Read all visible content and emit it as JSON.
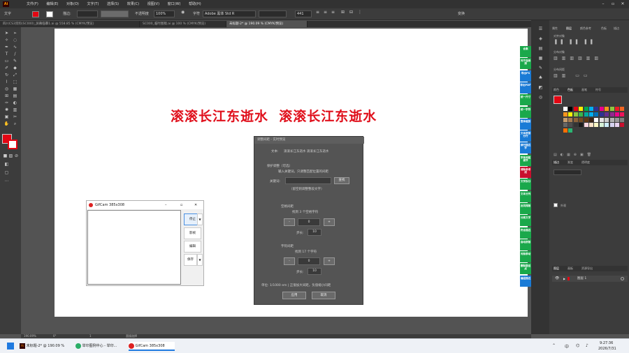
{
  "menubar": {
    "menus": [
      "文件(F)",
      "编辑(E)",
      "对象(O)",
      "文字(T)",
      "选择(S)",
      "效果(C)",
      "视图(V)",
      "窗口(W)",
      "帮助(H)"
    ]
  },
  "control_bar": {
    "object_type": "文字",
    "stroke_label": "描边:",
    "opacity_label": "不透明度",
    "opacity_value": "100%",
    "character_label": "字符",
    "font_name": "Adobe 黑体 Std R",
    "font_size": "441",
    "transform_label": "变换"
  },
  "doc_tabs": [
    "四川CS3资料(SC000)_屏幕临摹1.ai @ 558.85 % (CMYK/预览)",
    "SC000_临时图稿.ai @ 100 % (CMYK/预览)",
    "未标题-2* @ 190.09 % (CMYK/预览)"
  ],
  "artboard": {
    "headline": "滚滚长江东逝水  滚滚长江东逝水"
  },
  "dialog": {
    "title": "调整间距 - 实时预览",
    "text_label": "文本:",
    "text_value": "滚滚长江东逝水  滚滚长江东逝水",
    "keyword_section": "保护调整（可选）",
    "keyword_hint": "输入关键词，只调整匹配位置的间距",
    "keyword_label": "关键词:",
    "find_button": "查找",
    "keyword_note": "（留空则调整整段文字）",
    "space_section": "空格间距",
    "space_found": "找到 3 个空格字符",
    "space_value": "0",
    "step_label": "步长:",
    "space_step": "10",
    "char_section": "字符间距",
    "char_found": "找到 17 个字符",
    "char_value": "0",
    "char_step": "10",
    "unit_note": "单位: 1/1000 em  |  正值加大间距，负值缩小间距",
    "apply_button": "应用",
    "cancel_button": "取消",
    "minus": "-",
    "plus": "+"
  },
  "gifcam": {
    "title": "GifCam 385x308",
    "stop_button": "停止",
    "frame_button": "影帧",
    "edit_button": "编辑",
    "save_button": "保存"
  },
  "plugins": [
    "合集",
    "对齐连续排",
    "导出PS",
    "导出PDF",
    "统一尺寸",
    "统一字符",
    "整体缩放",
    "文本拼接分行",
    "修行描边字",
    "字体间距调节",
    "消除参考线",
    "文字拆分",
    "文本分列",
    "反向排版",
    "分离文字",
    "符合描边",
    "自动拼版",
    "对象移动",
    "删除路径点",
    "编组描边"
  ],
  "right_panel": {
    "top_tabs": [
      "属性",
      "图层",
      "颜色参考",
      "色板",
      "描边"
    ],
    "sections": [
      "对齐对象",
      "分布对象",
      "分布间距",
      "对齐"
    ],
    "swatch_tabs": [
      "颜色",
      "色板",
      "画笔",
      "符号"
    ],
    "stroke_tabs": [
      "描边",
      "渐变",
      "透明度"
    ],
    "layers_tabs": [
      "图层",
      "画板",
      "资源导出"
    ],
    "layer_name": "图层 1",
    "appearance_label": "外观"
  },
  "status_bar": {
    "zoom": "190.09%",
    "angle": "0°",
    "page": "1",
    "tool": "直接选择"
  },
  "taskbar": {
    "items": [
      "未标题-2* @ 190.09 %",
      "举印图例中心 - 举印...",
      "GifCam 385x308"
    ],
    "time": "9:27:36",
    "date": "2026/7/31"
  },
  "colors": {
    "accent_red": "#e0101c",
    "fill_swatch": "#e30613",
    "plugin_blue": "#1a7bd6",
    "plugin_green": "#1aa84b"
  }
}
